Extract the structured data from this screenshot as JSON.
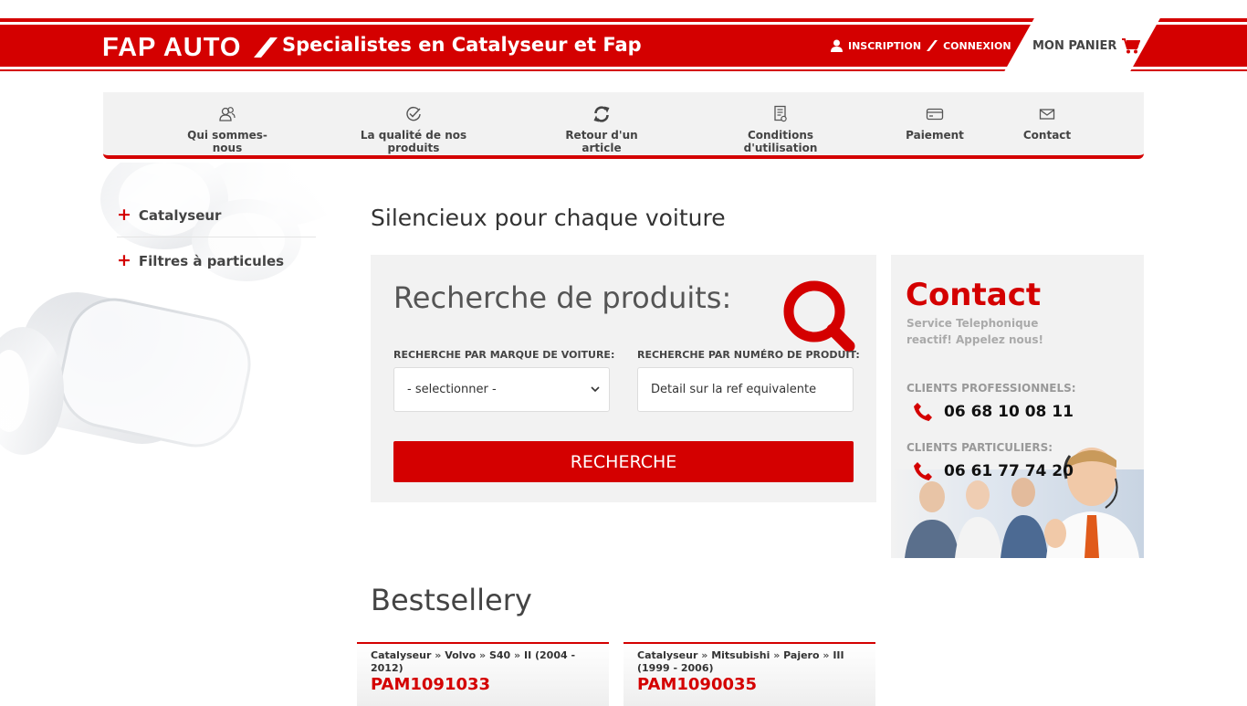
{
  "header": {
    "logo": "FAP AUTO",
    "tagline": "Specialistes en Catalyseur et Fap",
    "inscription": "INSCRIPTION",
    "connexion": "CONNEXION",
    "cart_label": "MON PANIER"
  },
  "nav": {
    "items": [
      {
        "label": "Qui sommes-nous",
        "icon": "users-icon"
      },
      {
        "label": "La qualité de nos produits",
        "icon": "check-circle-icon"
      },
      {
        "label": "Retour d'un article",
        "icon": "refresh-icon"
      },
      {
        "label": "Conditions d'utilisation",
        "icon": "document-icon"
      },
      {
        "label": "Paiement",
        "icon": "credit-card-icon"
      },
      {
        "label": "Contact",
        "icon": "envelope-icon"
      }
    ]
  },
  "sidebar": {
    "items": [
      {
        "label": "Catalyseur"
      },
      {
        "label": "Filtres à particules"
      }
    ]
  },
  "main": {
    "heading": "Silencieux pour chaque voiture",
    "search": {
      "title": "Recherche de produits:",
      "brand_label": "RECHERCHE PAR MARQUE DE VOITURE:",
      "brand_value": "- selectionner -",
      "number_label": "RECHERCHE PAR NUMÉRO DE PRODUIT:",
      "number_placeholder": "Detail sur la ref equivalente",
      "button": "RECHERCHE"
    }
  },
  "contact": {
    "title": "Contact",
    "subtitle": "Service Telephonique reactif! Appelez nous!",
    "pro_label": "CLIENTS PROFESSIONNELS:",
    "pro_phone": "06 68 10 08 11",
    "part_label": "CLIENTS PARTICULIERS:",
    "part_phone": "06 61 77 74 20"
  },
  "bestsellers": {
    "title": "Bestsellery",
    "items": [
      {
        "crumbs": [
          "Catalyseur",
          "Volvo",
          "S40",
          "II (2004 - 2012)"
        ],
        "ref": "PAM1091033"
      },
      {
        "crumbs": [
          "Catalyseur",
          "Mitsubishi",
          "Pajero",
          "III (1999 - 2006)"
        ],
        "ref": "PAM1090035"
      }
    ]
  },
  "colors": {
    "brand_red": "#d40000",
    "panel_gray": "#f2f2f2"
  }
}
